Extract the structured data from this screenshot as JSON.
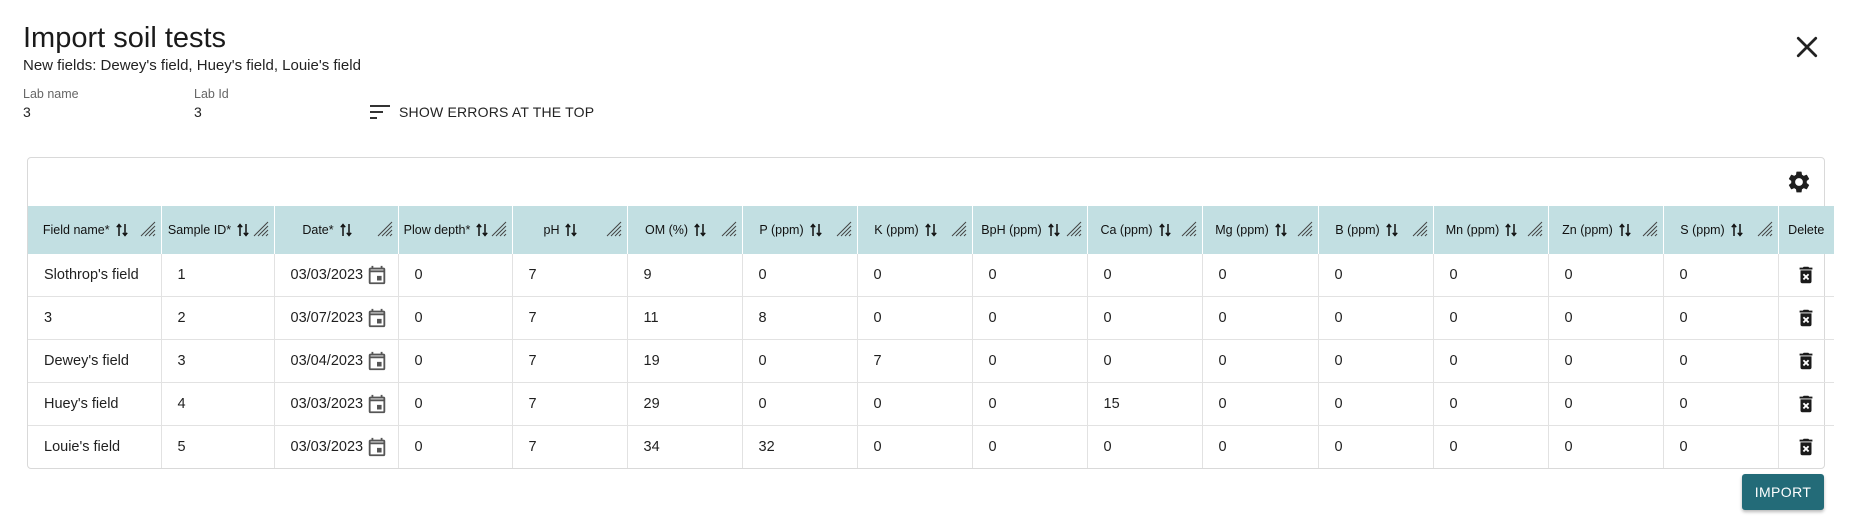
{
  "dialog": {
    "title": "Import soil tests",
    "subtitle": "New fields: Dewey's field, Huey's field, Louie's field",
    "close_icon": "close-icon"
  },
  "meta": {
    "lab_name_label": "Lab name",
    "lab_name_value": "3",
    "lab_id_label": "Lab Id",
    "lab_id_value": "3"
  },
  "sort_errors": {
    "label": "SHOW ERRORS AT THE TOP",
    "icon": "sort-lines-icon"
  },
  "table": {
    "settings_icon": "gear-icon",
    "columns": [
      "Field name*",
      "Sample ID*",
      "Date*",
      "Plow depth*",
      "pH",
      "OM (%)",
      "P (ppm)",
      "K (ppm)",
      "BpH (ppm)",
      "Ca (ppm)",
      "Mg (ppm)",
      "B (ppm)",
      "Mn (ppm)",
      "Zn (ppm)",
      "S (ppm)",
      "Delete"
    ],
    "rows": [
      [
        "Slothrop's field",
        "1",
        "03/03/2023",
        "0",
        "7",
        "9",
        "0",
        "0",
        "0",
        "0",
        "0",
        "0",
        "0",
        "0",
        "0"
      ],
      [
        "3",
        "2",
        "03/07/2023",
        "0",
        "7",
        "11",
        "8",
        "0",
        "0",
        "0",
        "0",
        "0",
        "0",
        "0",
        "0"
      ],
      [
        "Dewey's field",
        "3",
        "03/04/2023",
        "0",
        "7",
        "19",
        "0",
        "7",
        "0",
        "0",
        "0",
        "0",
        "0",
        "0",
        "0"
      ],
      [
        "Huey's field",
        "4",
        "03/03/2023",
        "0",
        "7",
        "29",
        "0",
        "0",
        "0",
        "15",
        "0",
        "0",
        "0",
        "0",
        "0"
      ],
      [
        "Louie's field",
        "5",
        "03/03/2023",
        "0",
        "7",
        "34",
        "32",
        "0",
        "0",
        "0",
        "0",
        "0",
        "0",
        "0",
        "0"
      ]
    ]
  },
  "footer": {
    "import_label": "IMPORT"
  },
  "colors": {
    "header_bg": "#c2dfe2",
    "primary_button": "#236b78",
    "icon": "#555555"
  }
}
